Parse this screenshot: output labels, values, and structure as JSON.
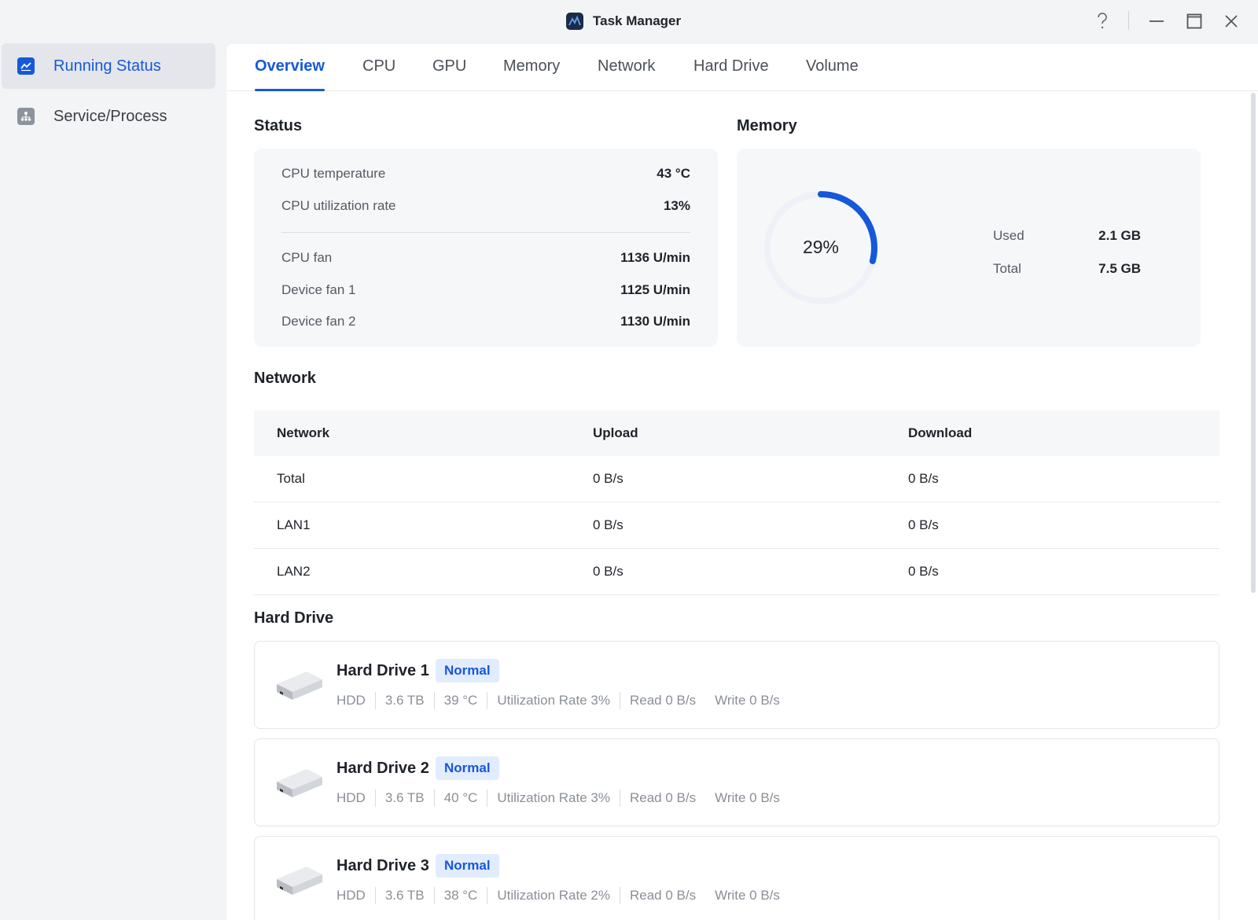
{
  "window": {
    "title": "Task Manager"
  },
  "sidebar": {
    "items": [
      {
        "label": "Running Status",
        "icon": "chart-icon",
        "active": true
      },
      {
        "label": "Service/Process",
        "icon": "hierarchy-icon",
        "active": false
      }
    ]
  },
  "tabs": [
    "Overview",
    "CPU",
    "GPU",
    "Memory",
    "Network",
    "Hard Drive",
    "Volume"
  ],
  "status": {
    "title": "Status",
    "rows": [
      {
        "label": "CPU temperature",
        "value": "43 °C"
      },
      {
        "label": "CPU utilization rate",
        "value": "13%"
      },
      {
        "label": "CPU fan",
        "value": "1136 U/min"
      },
      {
        "label": "Device fan 1",
        "value": "1125 U/min"
      },
      {
        "label": "Device fan 2",
        "value": "1130 U/min"
      }
    ]
  },
  "memory": {
    "title": "Memory",
    "percent_label": "29%",
    "percent": 0.29,
    "used_label": "Used",
    "used_value": "2.1 GB",
    "total_label": "Total",
    "total_value": "7.5 GB",
    "ring_color": "#1658d9",
    "track_color": "#eef1f8"
  },
  "network": {
    "title": "Network",
    "headers": [
      "Network",
      "Upload",
      "Download"
    ],
    "rows": [
      [
        "Total",
        "0 B/s",
        "0 B/s"
      ],
      [
        "LAN1",
        "0 B/s",
        "0 B/s"
      ],
      [
        "LAN2",
        "0 B/s",
        "0 B/s"
      ]
    ]
  },
  "hard_drive": {
    "title": "Hard Drive",
    "drives": [
      {
        "name": "Hard Drive 1",
        "status": "Normal",
        "type": "HDD",
        "size": "3.6 TB",
        "temp": "39 °C",
        "util": "Utilization Rate 3%",
        "read": "Read 0 B/s",
        "write": "Write 0 B/s"
      },
      {
        "name": "Hard Drive 2",
        "status": "Normal",
        "type": "HDD",
        "size": "3.6 TB",
        "temp": "40 °C",
        "util": "Utilization Rate 3%",
        "read": "Read 0 B/s",
        "write": "Write 0 B/s"
      },
      {
        "name": "Hard Drive 3",
        "status": "Normal",
        "type": "HDD",
        "size": "3.6 TB",
        "temp": "38 °C",
        "util": "Utilization Rate 2%",
        "read": "Read 0 B/s",
        "write": "Write 0 B/s"
      }
    ]
  }
}
